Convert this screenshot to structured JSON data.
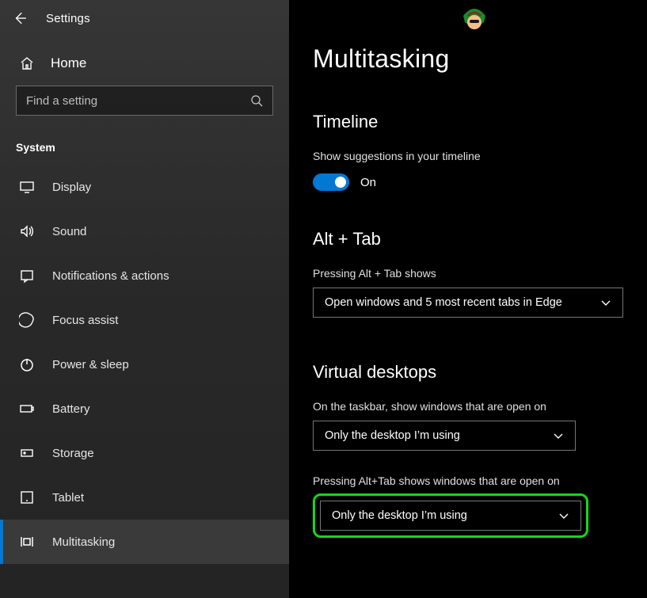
{
  "header": {
    "title": "Settings"
  },
  "home": {
    "label": "Home"
  },
  "search": {
    "placeholder": "Find a setting"
  },
  "group": {
    "label": "System"
  },
  "nav": {
    "items": [
      {
        "label": "Display"
      },
      {
        "label": "Sound"
      },
      {
        "label": "Notifications & actions"
      },
      {
        "label": "Focus assist"
      },
      {
        "label": "Power & sleep"
      },
      {
        "label": "Battery"
      },
      {
        "label": "Storage"
      },
      {
        "label": "Tablet"
      },
      {
        "label": "Multitasking"
      }
    ]
  },
  "page": {
    "title": "Multitasking"
  },
  "timeline": {
    "heading": "Timeline",
    "desc": "Show suggestions in your timeline",
    "toggle_state": "On"
  },
  "alttab": {
    "heading": "Alt + Tab",
    "desc": "Pressing Alt + Tab shows",
    "selected": "Open windows and 5 most recent tabs in Edge"
  },
  "vdesk": {
    "heading": "Virtual desktops",
    "q1": "On the taskbar, show windows that are open on",
    "a1": "Only the desktop I’m using",
    "q2": "Pressing Alt+Tab shows windows that are open on",
    "a2": "Only the desktop I’m using"
  }
}
